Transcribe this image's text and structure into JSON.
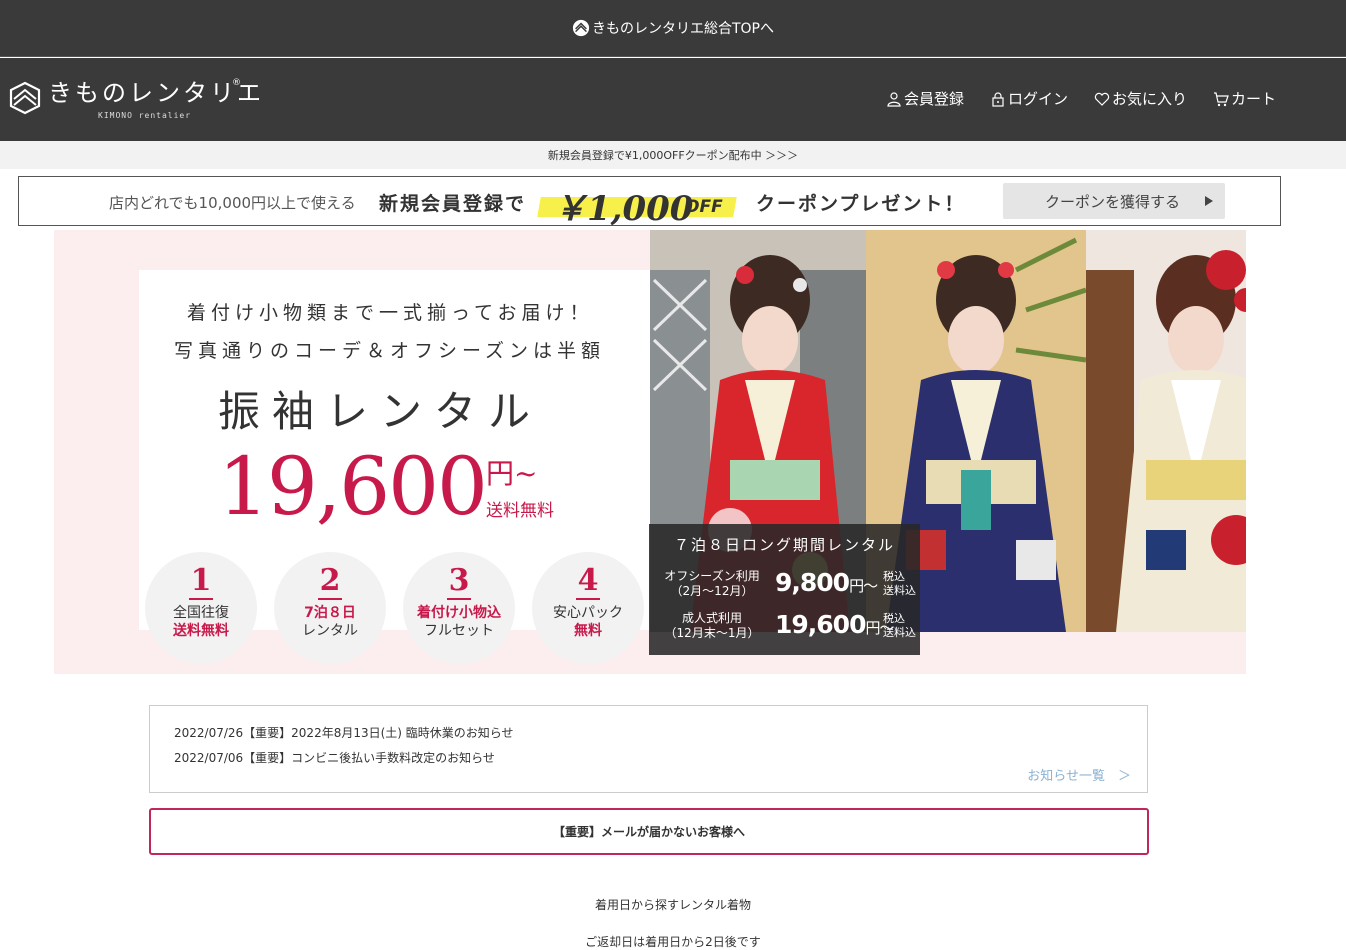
{
  "topbar": {
    "link_label": "きものレンタリエ総合TOPへ"
  },
  "brand": {
    "name": "きものレンタリエ",
    "registered": "®",
    "sub": "KIMONO rentalier"
  },
  "nav": [
    {
      "label": "会員登録",
      "icon": "person-icon"
    },
    {
      "label": "ログイン",
      "icon": "lock-icon"
    },
    {
      "label": "お気に入り",
      "icon": "heart-icon"
    },
    {
      "label": "カート",
      "icon": "cart-icon"
    }
  ],
  "promo_strip": {
    "text": "新規会員登録で¥1,000OFFクーポン配布中 ＞＞＞"
  },
  "coupon_banner": {
    "text1": "店内どれでも10,000円以上で使える",
    "text2": "新規会員登録で",
    "price": "￥1,000",
    "off": "OFF",
    "text3": "クーポンプレゼント！",
    "button_label": "クーポンを獲得する"
  },
  "hero": {
    "line1": "着付け小物類まで一式揃ってお届け！",
    "line2": "写真通りのコーデ＆オフシーズンは半額",
    "title": "振袖レンタル",
    "price": "19,600",
    "price_unit": "円~",
    "free_shipping": "送料無料",
    "features": [
      {
        "num": "1",
        "line1": "全国往復",
        "line2": "送料無料"
      },
      {
        "num": "2",
        "line1": "7泊８日",
        "line2": "レンタル"
      },
      {
        "num": "3",
        "line1": "着付け小物込",
        "line2": "フルセット"
      },
      {
        "num": "4",
        "line1": "安心パック",
        "line2": "無料"
      }
    ],
    "long_rental": {
      "title": "７泊８日ロング期間レンタル",
      "rows": [
        {
          "label1": "オフシーズン利用",
          "label2": "（2月〜12月）",
          "price": "9,800",
          "unit": "円〜",
          "tax1": "税込",
          "tax2": "送料込"
        },
        {
          "label1": "成人式利用",
          "label2": "（12月末〜1月）",
          "price": "19,600",
          "unit": "円〜",
          "tax1": "税込",
          "tax2": "送料込"
        }
      ]
    }
  },
  "news": {
    "items": [
      "2022/07/26【重要】2022年8月13日(土) 臨時休業のお知らせ",
      "2022/07/06【重要】コンビニ後払い手数料改定のお知らせ"
    ],
    "more_label": "お知らせ一覧　＞"
  },
  "alert": {
    "label": "【重要】メールが届かないお客様へ"
  },
  "section": {
    "title": "着用日から探すレンタル着物",
    "sub": "ご返却日は着用日から2日後です"
  },
  "colors": {
    "dark_bg": "#3a3a3a",
    "accent_red": "#c8194b",
    "hero_pink": "#fcedee",
    "highlight_yellow": "#f7f04a"
  }
}
